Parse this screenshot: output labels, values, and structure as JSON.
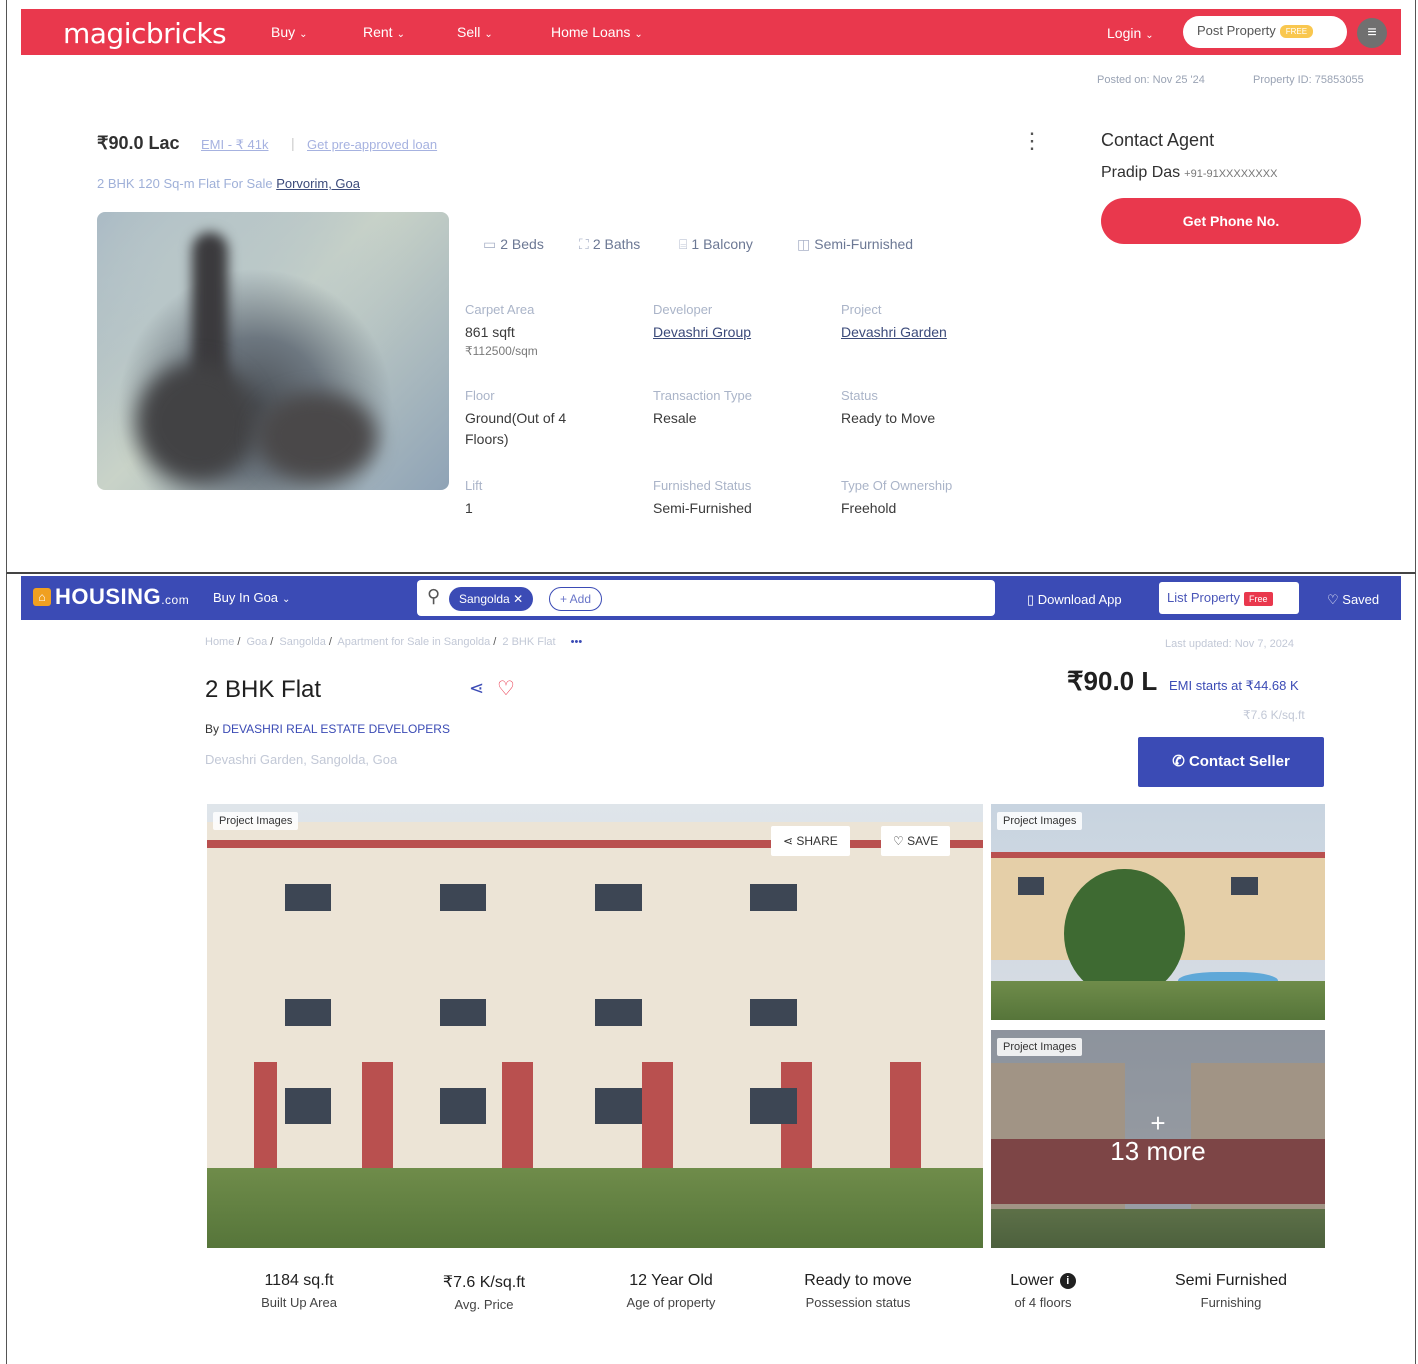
{
  "magicbricks": {
    "nav": {
      "logo": "magicbricks",
      "menu": [
        "Buy",
        "Rent",
        "Sell",
        "Home Loans"
      ],
      "login": "Login",
      "post_property": "Post Property",
      "post_badge": "FREE"
    },
    "meta": {
      "posted_on": "Posted on: Nov 25 '24",
      "property_id": "Property ID: 75853055"
    },
    "price": "₹90.0 Lac",
    "emi": "EMI - ₹ 41k",
    "loan": "Get pre-approved loan",
    "subtitle_prefix": "2 BHK 120 Sq-m Flat For Sale",
    "subtitle_location": "Porvorim, Goa",
    "features": [
      "2 Beds",
      "2 Baths",
      "1 Balcony",
      "Semi-Furnished"
    ],
    "details": [
      {
        "label": "Carpet Area",
        "value": "861 sqft",
        "sub": "₹112500/sqm"
      },
      {
        "label": "Developer",
        "value": "Devashri Group"
      },
      {
        "label": "Project",
        "value": "Devashri Garden"
      },
      {
        "label": "Floor",
        "value": "Ground(Out of 4 Floors)"
      },
      {
        "label": "Transaction Type",
        "value": "Resale"
      },
      {
        "label": "Status",
        "value": "Ready to Move"
      },
      {
        "label": "Lift",
        "value": "1"
      },
      {
        "label": "Furnished Status",
        "value": "Semi-Furnished"
      },
      {
        "label": "Type Of Ownership",
        "value": "Freehold"
      }
    ],
    "contact": {
      "title": "Contact Agent",
      "agent": "Pradip Das",
      "phone": "+91-91XXXXXXXX",
      "button": "Get Phone No."
    }
  },
  "housing": {
    "nav": {
      "logo": "HOUSING",
      "logo_suffix": ".com",
      "city": "Buy In Goa",
      "search_chip": "Sangolda",
      "add": "+ Add",
      "download": "Download App",
      "list_property": "List Property",
      "free": "Free",
      "saved": "Saved"
    },
    "breadcrumb": [
      "Home",
      "Goa",
      "Sangolda",
      "Apartment for Sale in Sangolda",
      "2 BHK Flat"
    ],
    "breadcrumb_more": "•••",
    "last_updated": "Last updated: Nov 7, 2024",
    "title": "2 BHK Flat",
    "by_prefix": "By",
    "developer": "DEVASHRI REAL ESTATE DEVELOPERS",
    "location": "Devashri Garden, Sangolda, Goa",
    "price": "₹90.0 L",
    "emi": "EMI starts at ₹44.68 K",
    "rate": "₹7.6 K/sq.ft",
    "contact_button": "Contact Seller",
    "images": {
      "tag": "Project Images",
      "share": "SHARE",
      "save": "SAVE",
      "more_plus": "+",
      "more": "13 more"
    },
    "stats": [
      {
        "value": "1184 sq.ft",
        "label": "Built Up Area"
      },
      {
        "value": "₹7.6 K/sq.ft",
        "label": "Avg. Price"
      },
      {
        "value": "12 Year Old",
        "label": "Age of property"
      },
      {
        "value": "Ready to move",
        "label": "Possession status"
      },
      {
        "value": "Lower",
        "label": "of 4 floors"
      },
      {
        "value": "Semi Furnished",
        "label": "Furnishing"
      }
    ],
    "colors": {
      "brand": "#3b4bb5",
      "accent": "#e9384d"
    }
  }
}
